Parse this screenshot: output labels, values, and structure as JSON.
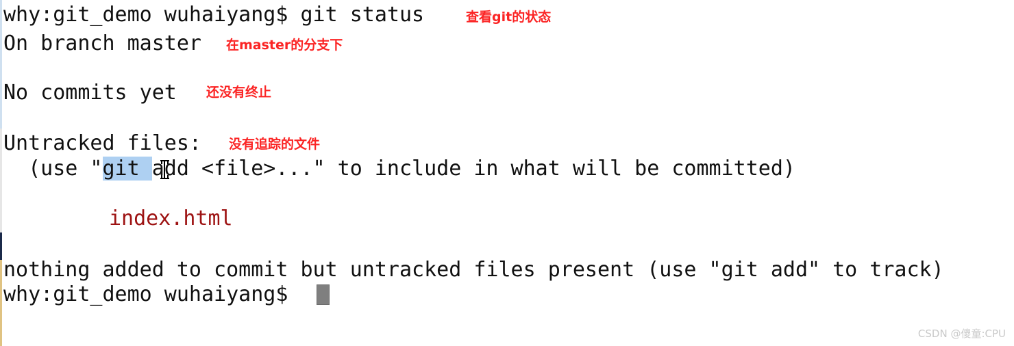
{
  "terminal": {
    "background_color": "#ffffff",
    "text_color": "#111111",
    "annotation_color": "#fb2424",
    "untracked_file_color": "#9d1212",
    "selection_color": "#aed0f2",
    "cursor_color": "#7f7f7f",
    "lines": {
      "prompt_command": "why:git_demo wuhaiyang$ git status",
      "branch": "On branch master",
      "no_commits": "No commits yet",
      "untracked_header": "Untracked files:",
      "hint_before_selection": "  (use \"",
      "hint_selected": "git ",
      "hint_after_selection": "add <file>...\" to include in what will be committed)",
      "untracked_file": "index.html",
      "summary": "nothing added to commit but untracked files present (use \"git add\" to track)",
      "prompt_trailing": "why:git_demo wuhaiyang$ "
    },
    "annotations": {
      "status": "查看git的状态",
      "branch": "在master的分支下",
      "no_commits": "还没有终止",
      "untracked": "没有追踪的文件"
    }
  },
  "watermark": {
    "text": "CSDN @傻童:CPU"
  }
}
